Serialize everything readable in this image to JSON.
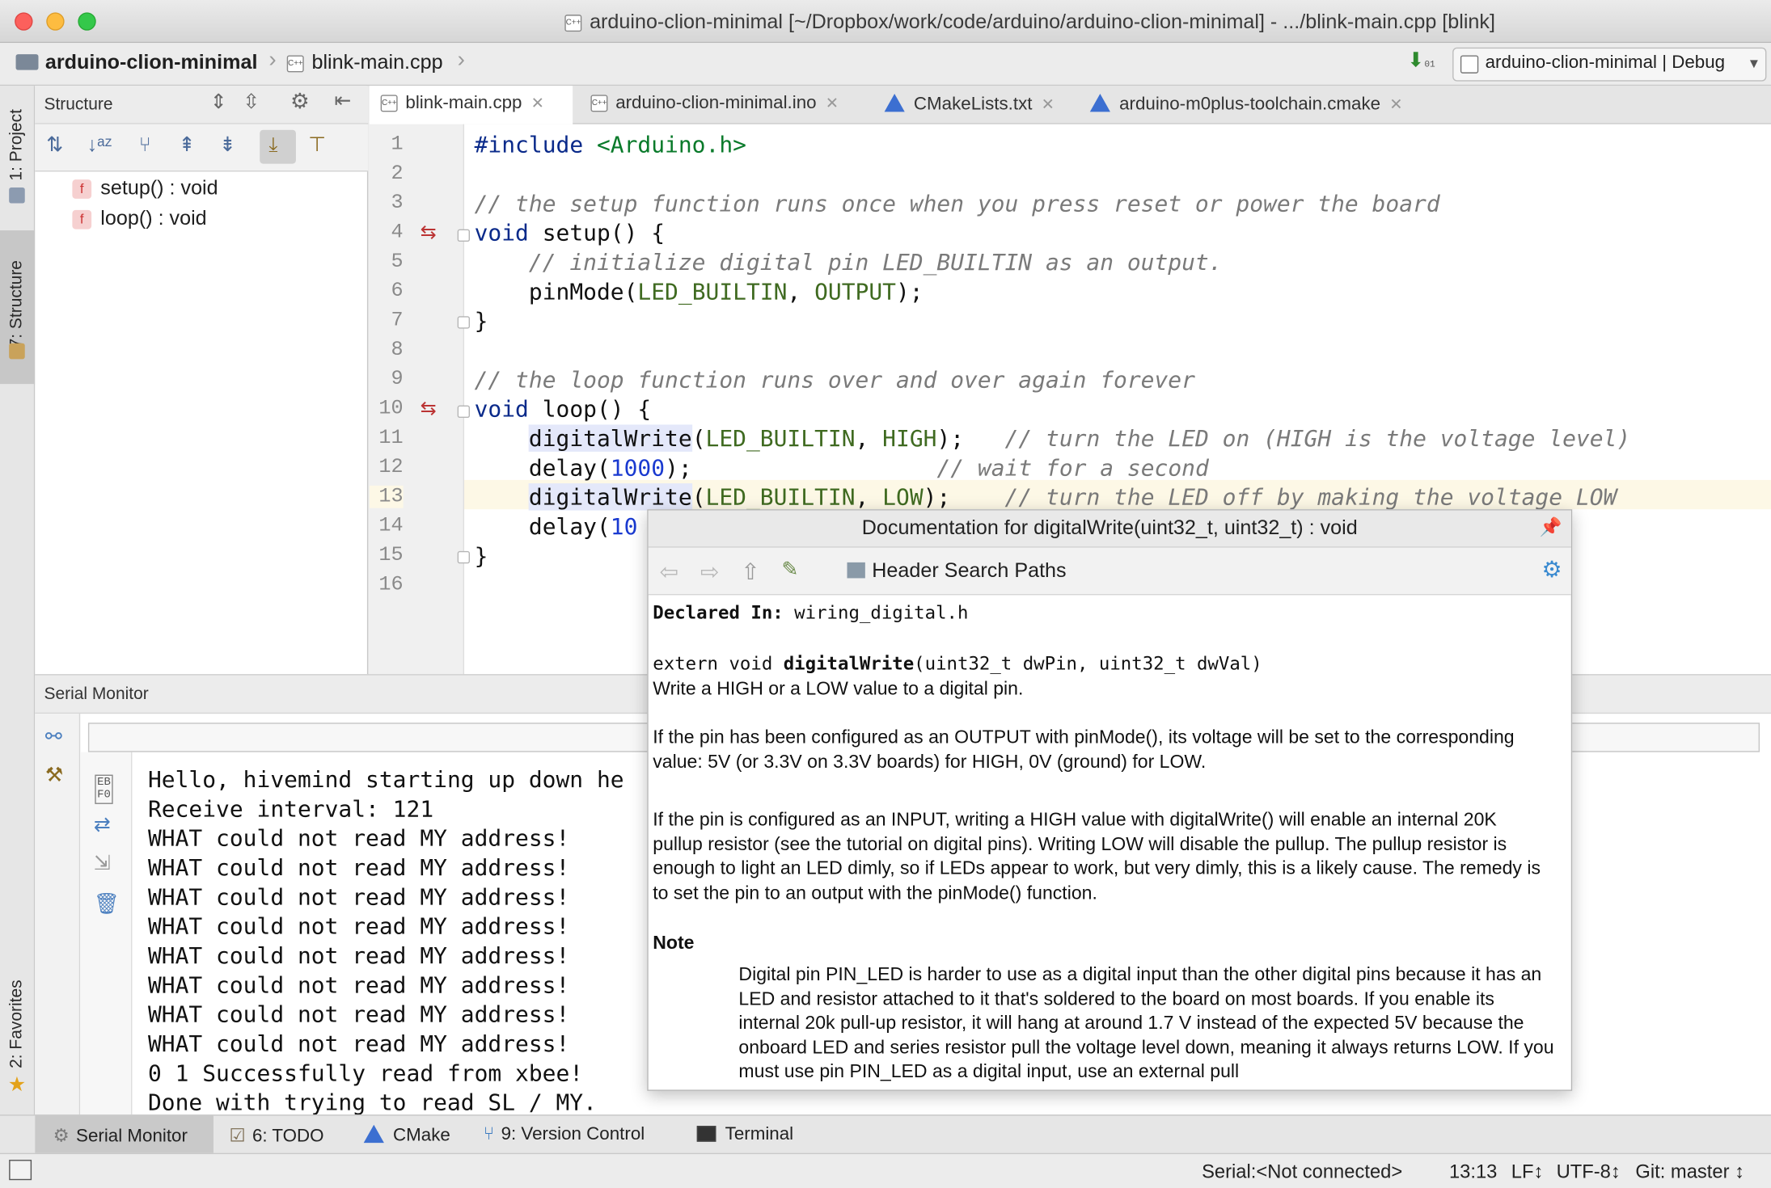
{
  "window": {
    "title": "arduino-clion-minimal [~/Dropbox/work/code/arduino/arduino-clion-minimal] - .../blink-main.cpp [blink]",
    "file_badge": "C++"
  },
  "navbar": {
    "project": "arduino-clion-minimal",
    "file": "blink-main.cpp",
    "run_config": "arduino-clion-minimal | Debug"
  },
  "left_stripe": {
    "project_tab": "1: Project",
    "structure_tab": "7: Structure",
    "favorites_tab": "2: Favorites"
  },
  "structure": {
    "title": "Structure",
    "items": [
      {
        "badge": "f",
        "label": "setup() : void"
      },
      {
        "badge": "f",
        "label": "loop() : void"
      }
    ]
  },
  "tabs": [
    {
      "label": "blink-main.cpp",
      "icon": "cpp-file-icon",
      "active": true
    },
    {
      "label": "arduino-clion-minimal.ino",
      "icon": "cpp-file-icon",
      "active": false
    },
    {
      "label": "CMakeLists.txt",
      "icon": "cmake-icon",
      "active": false
    },
    {
      "label": "arduino-m0plus-toolchain.cmake",
      "icon": "cmake-icon",
      "active": false
    }
  ],
  "editor": {
    "line_numbers": [
      "1",
      "2",
      "3",
      "4",
      "5",
      "6",
      "7",
      "8",
      "9",
      "10",
      "11",
      "12",
      "13",
      "14",
      "15",
      "16"
    ],
    "current_line": 13,
    "lines": {
      "l1_directive": "#include",
      "l1_header": " <Arduino.h>",
      "l3_comment": "// the setup function runs once when you press reset or power the board",
      "l4_kw": "void",
      "l4_rest": " setup() {",
      "l5_comment": "    // initialize digital pin LED_BUILTIN as an output.",
      "l6_indent": "    pinMode(",
      "l6_a": "LED_BUILTIN",
      "l6_sep": ", ",
      "l6_b": "OUTPUT",
      "l6_end": ");",
      "l7": "}",
      "l9_comment": "// the loop function runs over and over again forever",
      "l10_kw": "void",
      "l10_rest": " loop() {",
      "l11_indent": "    ",
      "l11_fn": "digitalWrite",
      "l11_paren": "(",
      "l11_a": "LED_BUILTIN",
      "l11_sep": ", ",
      "l11_b": "HIGH",
      "l11_end": ");   ",
      "l11_comment": "// turn the LED on (HIGH is the voltage level)",
      "l12_pre": "    delay(",
      "l12_num": "1000",
      "l12_end": ");",
      "l12_pad": "                  ",
      "l12_comment": "// wait for a second",
      "l13_indent": "    ",
      "l13_fn": "digitalWrite",
      "l13_paren": "(",
      "l13_a": "LED_BUILTIN",
      "l13_sep": ", ",
      "l13_b": "LOW",
      "l13_end": ");    ",
      "l13_comment": "// turn the LED off by making the voltage LOW",
      "l14_pre": "    delay(",
      "l14_num": "10",
      "l15": "}"
    }
  },
  "serial": {
    "title": "Serial Monitor",
    "output": [
      "Hello, hivemind starting up down he",
      "Receive interval: 121",
      "WHAT could not read MY address!",
      "WHAT could not read MY address!",
      "WHAT could not read MY address!",
      "WHAT could not read MY address!",
      "WHAT could not read MY address!",
      "WHAT could not read MY address!",
      "WHAT could not read MY address!",
      "WHAT could not read MY address!",
      "0 1 Successfully read from xbee!",
      "Done with trying to read SL / MY."
    ]
  },
  "doc": {
    "title": "Documentation for digitalWrite(uint32_t, uint32_t) : void",
    "toolbar_label": "Header Search Paths",
    "declared_label": "Declared In:",
    "declared_value": " wiring_digital.h",
    "sig_pre": "extern void ",
    "sig_fn": "digitalWrite",
    "sig_post": "(uint32_t dwPin, uint32_t dwVal)",
    "summary": "Write a HIGH or a LOW value to a digital pin.",
    "p1": "If the pin has been configured as an OUTPUT with pinMode(), its voltage will be set to the corresponding value: 5V (or 3.3V on 3.3V boards) for HIGH, 0V (ground) for LOW.",
    "p2": "If the pin is configured as an INPUT, writing a HIGH value with digitalWrite() will enable an internal 20K pullup resistor (see the tutorial on digital pins). Writing LOW will disable the pullup. The pullup resistor is enough to light an LED dimly, so if LEDs appear to work, but very dimly, this is a likely cause. The remedy is to set the pin to an output with the pinMode() function.",
    "note_heading": "Note",
    "note": "Digital pin PIN_LED is harder to use as a digital input than the other digital pins because it has an LED and resistor attached to it that's soldered to the board on most boards. If you enable its internal 20k pull-up resistor, it will hang at around 1.7 V instead of the expected 5V because the onboard LED and series resistor pull the voltage level down, meaning it always returns LOW. If you must use pin PIN_LED as a digital input, use an external pull"
  },
  "bottom_tabs": [
    {
      "label": "Serial Monitor",
      "icon": "serial-monitor-icon"
    },
    {
      "label": "6: TODO",
      "icon": "todo-icon"
    },
    {
      "label": "CMake",
      "icon": "cmake-icon"
    },
    {
      "label": "9: Version Control",
      "icon": "version-control-icon"
    },
    {
      "label": "Terminal",
      "icon": "terminal-icon"
    }
  ],
  "status": {
    "serial": "Serial:<Not connected>",
    "position": "13:13",
    "line_sep": "LF↕",
    "encoding": "UTF-8↕",
    "git": "Git: master ↕"
  },
  "colors": {
    "keyword": "#0a2a8a",
    "comment": "#7a7a7a",
    "string": "#097a2a",
    "number": "#1a3ad0",
    "current_line": "#fdf8e6"
  }
}
